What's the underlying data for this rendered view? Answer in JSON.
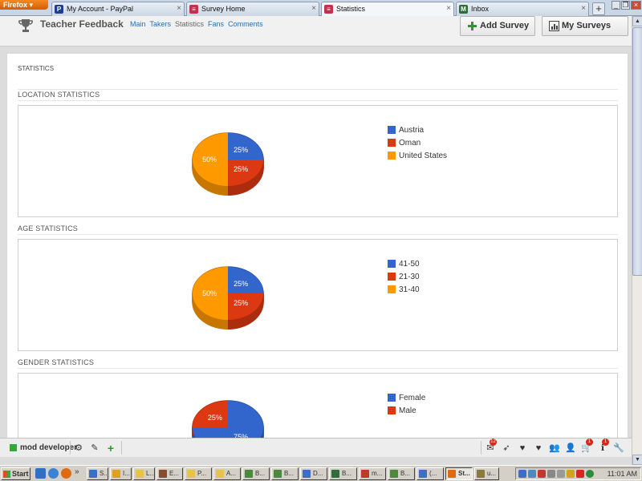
{
  "browser": {
    "firefox_label": "Firefox",
    "tabs": [
      {
        "label": "My Account - PayPal",
        "icon": "P",
        "icon_color": "#1c3f94",
        "active": false
      },
      {
        "label": "Survey Home",
        "icon": "≡",
        "icon_color": "#c0334a",
        "active": false
      },
      {
        "label": "Statistics",
        "icon": "≡",
        "icon_color": "#c0334a",
        "active": true
      },
      {
        "label": "Inbox",
        "icon": "M",
        "icon_color": "#2f6e3a",
        "active": false
      }
    ],
    "new_tab_label": "+",
    "tab_list_label": "▾"
  },
  "header": {
    "title": "Teacher Feedback",
    "nav": [
      {
        "label": "Main",
        "link": true
      },
      {
        "label": "Takers",
        "link": true
      },
      {
        "label": "Statistics",
        "link": false
      },
      {
        "label": "Fans",
        "link": true
      },
      {
        "label": "Comments",
        "link": true
      }
    ],
    "add_survey_label": "Add Survey",
    "my_surveys_label": "My Surveys"
  },
  "page": {
    "heading": "STATISTICS",
    "sections": [
      {
        "title": "LOCATION STATISTICS",
        "chart_data": {
          "type": "pie",
          "categories": [
            "Austria",
            "Oman",
            "United States"
          ],
          "values": [
            25,
            25,
            50
          ],
          "labels": [
            "25%",
            "25%",
            "50%"
          ],
          "colors": [
            "#3366cc",
            "#dc3912",
            "#ff9900"
          ]
        }
      },
      {
        "title": "AGE STATISTICS",
        "chart_data": {
          "type": "pie",
          "categories": [
            "41-50",
            "21-30",
            "31-40"
          ],
          "values": [
            25,
            25,
            50
          ],
          "labels": [
            "25%",
            "25%",
            "50%"
          ],
          "colors": [
            "#3366cc",
            "#dc3912",
            "#ff9900"
          ]
        }
      },
      {
        "title": "GENDER STATISTICS",
        "chart_data": {
          "type": "pie",
          "categories": [
            "Female",
            "Male"
          ],
          "values": [
            75,
            25
          ],
          "labels": [
            "75%",
            "25%"
          ],
          "colors": [
            "#3366cc",
            "#dc3912"
          ]
        }
      }
    ]
  },
  "devbar": {
    "user_name": "mod developer",
    "mail_badge": "12",
    "cart_badge": "1",
    "info_badge": "1"
  },
  "taskbar": {
    "start_label": "Start",
    "ql_overflow": "»",
    "tasks": [
      {
        "label": "S...",
        "color": "#3b6fc4"
      },
      {
        "label": "I...",
        "color": "#e0a020"
      },
      {
        "label": "L...",
        "color": "#e8c24a"
      },
      {
        "label": "E...",
        "color": "#8a4b2a"
      },
      {
        "label": "P...",
        "color": "#e8c24a"
      },
      {
        "label": "A...",
        "color": "#e8c24a"
      },
      {
        "label": "B...",
        "color": "#4b8a3b"
      },
      {
        "label": "B...",
        "color": "#4b8a3b"
      },
      {
        "label": "D...",
        "color": "#3b6fc4"
      },
      {
        "label": "B...",
        "color": "#2f6e3a"
      },
      {
        "label": "m...",
        "color": "#c0392b"
      },
      {
        "label": "B...",
        "color": "#4b8a3b"
      },
      {
        "label": "(...",
        "color": "#3b6fc4"
      },
      {
        "label": "St...",
        "color": "#e06a10",
        "pressed": true
      },
      {
        "label": "u...",
        "color": "#8a7a3b"
      }
    ],
    "clock": "11:01 AM"
  }
}
